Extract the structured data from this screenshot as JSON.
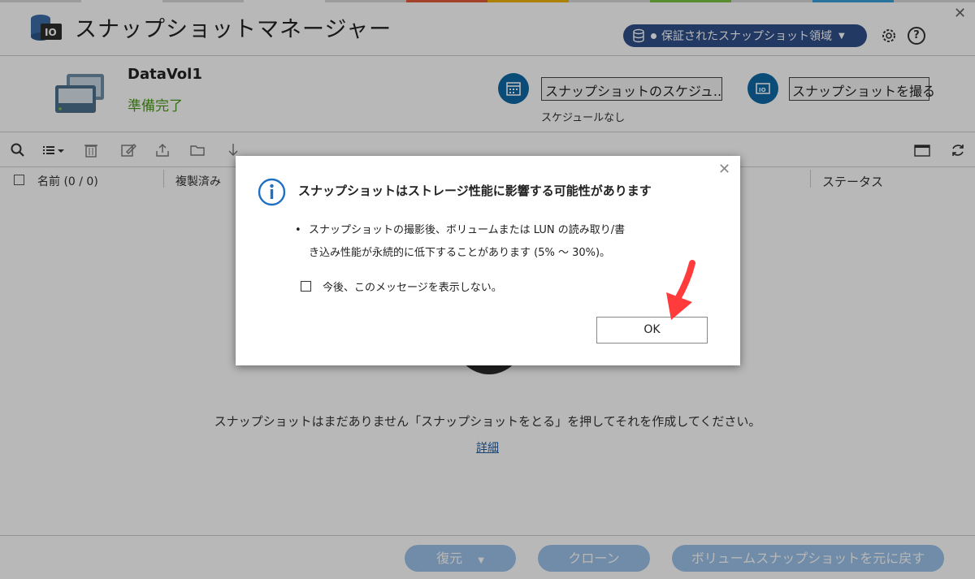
{
  "header": {
    "title": "スナップショットマネージャー",
    "snapshot_area_label": "保証されたスナップショット領域",
    "help_label": "?"
  },
  "volume": {
    "name": "DataVol1",
    "status": "準備完了",
    "schedule_button": "スナップショットのスケジュ...",
    "schedule_note": "スケジュールなし",
    "take_snapshot_button": "スナップショットを撮る"
  },
  "table": {
    "col_name": "名前 (0 / 0)",
    "col_replicated": "複製済み",
    "col_status": "ステータス"
  },
  "empty_state": {
    "message": "スナップショットはまだありません「スナップショットをとる」を押してそれを作成してください。",
    "detail_link": "詳細"
  },
  "footer": {
    "restore_label": "復元",
    "clone_label": "クローン",
    "revert_label": "ボリュームスナップショットを元に戻す"
  },
  "dialog": {
    "title": "スナップショットはストレージ性能に影響する可能性があります",
    "bullet": "•",
    "line1": "スナップショットの撮影後、ボリュームまたは LUN の読み取り/書",
    "line2": "き込み性能が永続的に低下することがあります (5% ～ 30%)。",
    "checkbox_label": "今後、このメッセージを表示しない。",
    "ok_label": "OK"
  },
  "colors": {
    "accent": "#0e6aa5",
    "status_ready": "#4c9a1a",
    "area_button": "#2e4f8a",
    "footer_button": "#9cc3ea",
    "arrow": "#ff3b3b"
  }
}
